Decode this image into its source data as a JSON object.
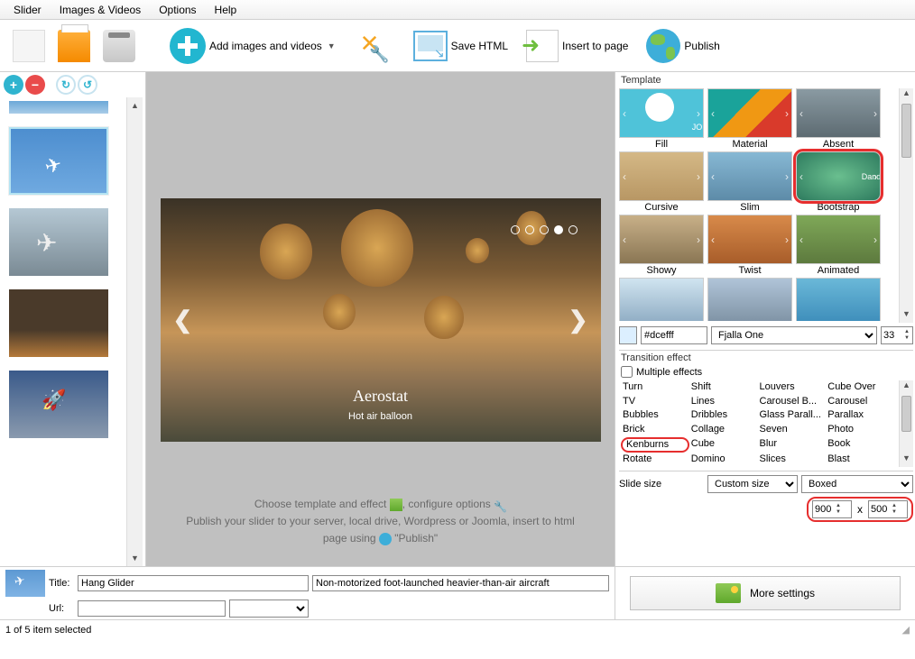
{
  "menu": {
    "slider": "Slider",
    "images": "Images & Videos",
    "options": "Options",
    "help": "Help"
  },
  "toolbar": {
    "add": "Add images and videos",
    "options": "",
    "savehtml": "Save HTML",
    "insert": "Insert to page",
    "publish": "Publish"
  },
  "preview": {
    "title": "Aerostat",
    "subtitle": "Hot air balloon",
    "hint1": "Choose template and effect ",
    "hint1b": ", configure options ",
    "hint2": "Publish your slider to your server, local drive, Wordpress or Joomla, insert to html",
    "hint3": "page using ",
    "hint3b": " \"Publish\""
  },
  "template": {
    "label": "Template",
    "items": [
      {
        "name": "Fill"
      },
      {
        "name": "Material"
      },
      {
        "name": "Absent"
      },
      {
        "name": "Cursive"
      },
      {
        "name": "Slim"
      },
      {
        "name": "Bootstrap",
        "selected": true
      },
      {
        "name": "Showy"
      },
      {
        "name": "Twist"
      },
      {
        "name": "Animated"
      }
    ],
    "color": "#dcefff",
    "font": "Fjalla One",
    "fontsize": "33"
  },
  "transition": {
    "label": "Transition effect",
    "multi": "Multiple effects",
    "effects": [
      "Turn",
      "Shift",
      "Louvers",
      "Cube Over",
      "TV",
      "Lines",
      "Carousel B...",
      "Carousel",
      "Bubbles",
      "Dribbles",
      "Glass Parall...",
      "Parallax",
      "Brick",
      "Collage",
      "Seven",
      "Photo",
      "Kenburns",
      "Cube",
      "Blur",
      "Book",
      "Rotate",
      "Domino",
      "Slices",
      "Blast"
    ],
    "selected": "Kenburns"
  },
  "slidesize": {
    "label": "Slide size",
    "mode": "Custom size",
    "box": "Boxed",
    "w": "900",
    "h": "500",
    "x": "x"
  },
  "properties": {
    "titleLbl": "Title:",
    "title": "Hang Glider",
    "desc": "Non-motorized foot-launched heavier-than-air aircraft",
    "urlLbl": "Url:",
    "url": ""
  },
  "more": "More settings",
  "status": "1 of 5 item selected"
}
